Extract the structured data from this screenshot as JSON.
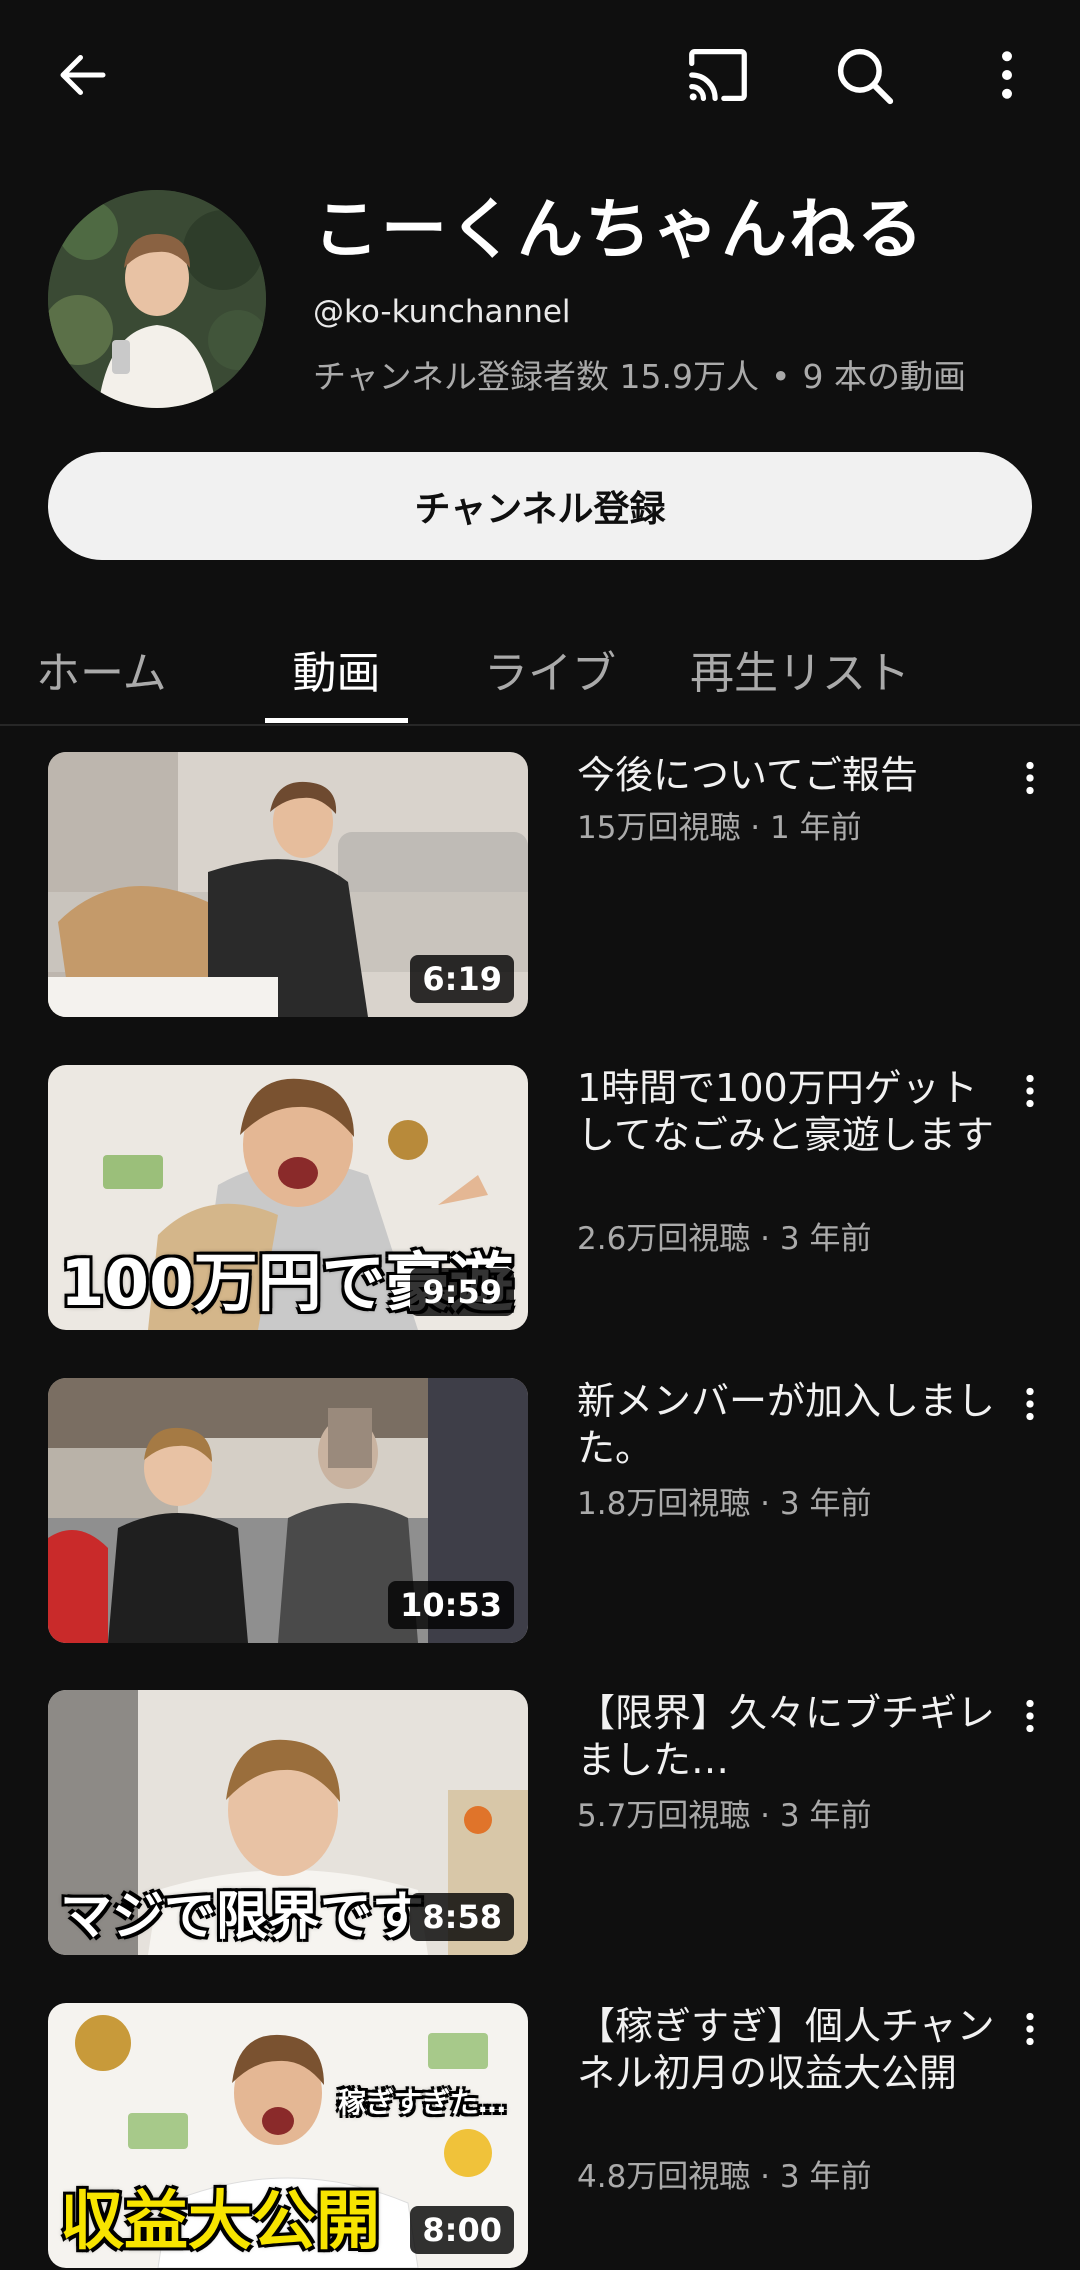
{
  "topbar": {
    "back_icon": "arrow-left-icon",
    "cast_icon": "cast-icon",
    "search_icon": "search-icon",
    "more_icon": "more-vert-icon"
  },
  "channel": {
    "name": "こーくんちゃんねる",
    "handle": "@ko-kunchannel",
    "subscribers": "チャンネル登録者数 15.9万人",
    "dot": "•",
    "video_count": "9 本の動画",
    "subscribe_label": "チャンネル登録"
  },
  "tabs": [
    {
      "label": "ホーム"
    },
    {
      "label": "動画"
    },
    {
      "label": "ライブ"
    },
    {
      "label": "再生リスト"
    }
  ],
  "videos": [
    {
      "title": "今後についてご報告",
      "meta": "15万回視聴 · 1 年前",
      "duration": "6:19"
    },
    {
      "title": "1時間で100万円ゲットしてなごみと豪遊します",
      "meta": "2.6万回視聴 · 3 年前",
      "duration": "9:59",
      "caption": "100万円で豪遊"
    },
    {
      "title": "新メンバーが加入しました。",
      "meta": "1.8万回視聴 · 3 年前",
      "duration": "10:53"
    },
    {
      "title": "【限界】久々にブチギレました…",
      "meta": "5.7万回視聴 · 3 年前",
      "duration": "8:58",
      "caption": "マジで限界です"
    },
    {
      "title": "【稼ぎすぎ】個人チャンネル初月の収益大公開",
      "meta": "4.8万回視聴 · 3 年前",
      "duration": "8:00",
      "caption": "収益大公開",
      "caption2": "稼ぎすぎた…"
    }
  ],
  "colors": {
    "background": "#0f0f0f",
    "primary_text": "#f1f1f1",
    "secondary_text": "#aaaaaa",
    "caption_yellow": "#f7e400"
  }
}
